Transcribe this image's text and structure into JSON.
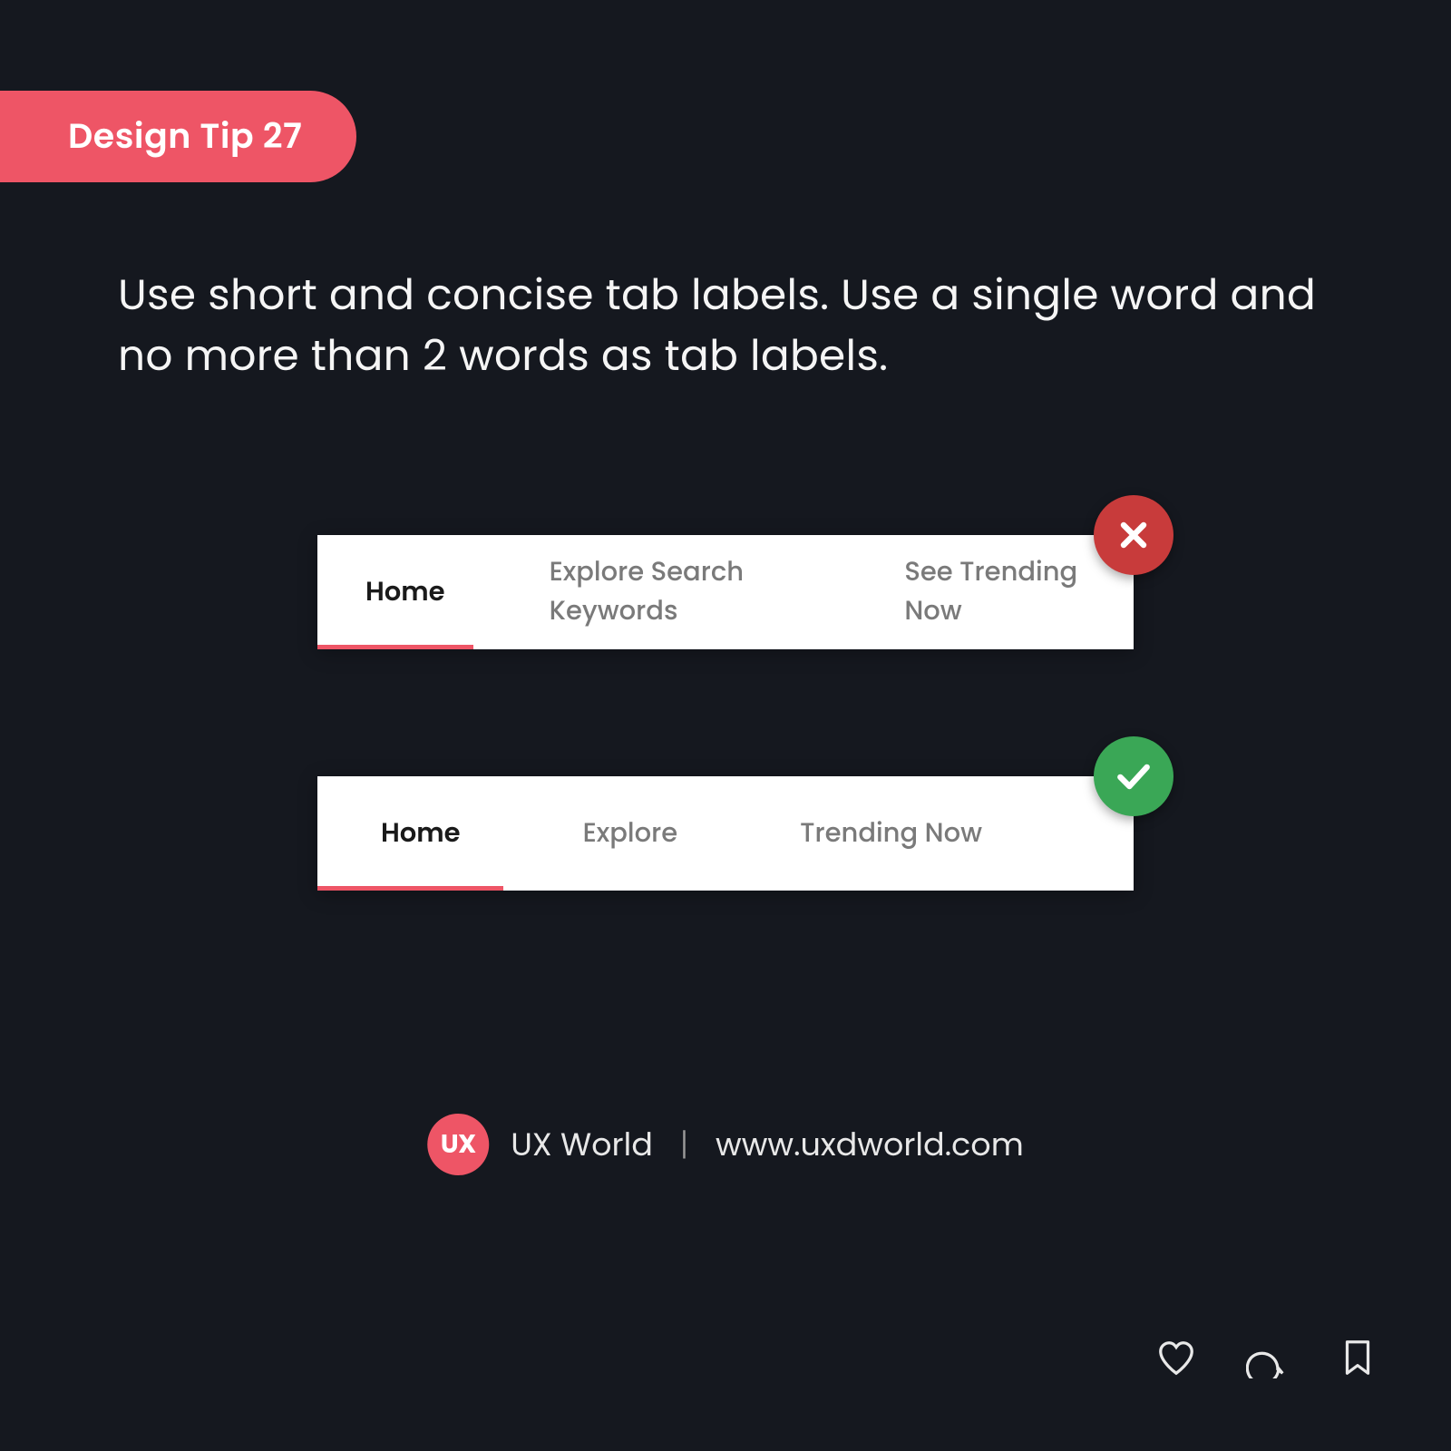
{
  "badge": {
    "label": "Design Tip 27"
  },
  "tip": "Use short and concise tab labels. Use a single word and no more than 2 words as tab labels.",
  "examples": {
    "bad": {
      "tabs": [
        "Home",
        "Explore Search Keywords",
        "See Trending Now"
      ],
      "active_index": 0,
      "status": "cross"
    },
    "good": {
      "tabs": [
        "Home",
        "Explore",
        "Trending Now"
      ],
      "active_index": 0,
      "status": "check"
    }
  },
  "brand": {
    "logo_text": "UX",
    "name": "UX World",
    "separator": "|",
    "url": "www.uxdworld.com"
  },
  "actions": {
    "like": "heart-icon",
    "comment": "comment-icon",
    "save": "bookmark-icon"
  },
  "colors": {
    "accent": "#ee5566",
    "bg": "#15181f",
    "success": "#3aa756",
    "error": "#c83b3b"
  }
}
